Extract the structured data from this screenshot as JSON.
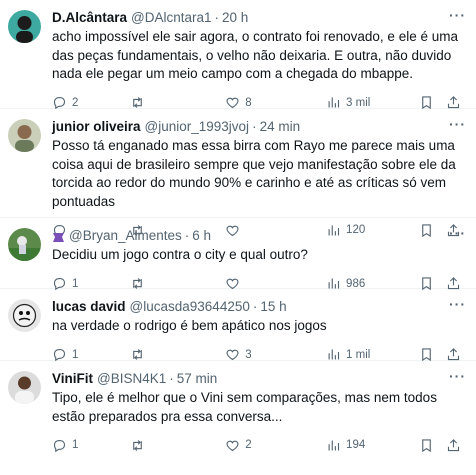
{
  "tweets": [
    {
      "name": "D.Alcântara",
      "handle": "@DAlcntara1",
      "time": "20 h",
      "text": "acho impossível ele sair agora, o contrato foi renovado, e ele é uma das peças fundamentais, o velho não deixaria. E outra, não duvido nada ele pegar um meio campo com a chegada do mbappe.",
      "replies": "2",
      "retweets": "",
      "likes": "8",
      "views": "3 mil"
    },
    {
      "name": "junior oliveira",
      "handle": "@junior_1993jvoj",
      "time": "24 min",
      "text": "Posso tá enganado mas essa birra com Rayo me parece mais uma coisa aqui de brasileiro sempre que vejo manifestação sobre ele da torcida ao redor do mundo 90% e carinho e até as críticas só vem pontuadas",
      "replies": "",
      "retweets": "",
      "likes": "",
      "views": "120"
    },
    {
      "name": "",
      "handle": "@Bryan_Almentes",
      "time": "6 h",
      "text": "Decidiu um jogo contra o city e qual outro?",
      "replies": "1",
      "retweets": "",
      "likes": "",
      "views": "986"
    },
    {
      "name": "lucas david",
      "handle": "@lucasda93644250",
      "time": "15 h",
      "text": "na verdade o rodrigo é bem apático nos jogos",
      "replies": "1",
      "retweets": "",
      "likes": "3",
      "views": "1 mil"
    },
    {
      "name": "ViniFit",
      "handle": "@BISN4K1",
      "time": "57 min",
      "text": "Tipo, ele é melhor que o Vini sem comparações, mas nem todos estão preparados pra essa conversa...",
      "replies": "1",
      "retweets": "",
      "likes": "2",
      "views": "194"
    }
  ],
  "icons": {
    "reply": "reply-icon",
    "retweet": "retweet-icon",
    "like": "like-icon",
    "views": "views-icon",
    "bookmark": "bookmark-icon",
    "share": "share-icon",
    "more": "more-icon"
  },
  "colors": {
    "text": "#0f1419",
    "secondary": "#536471",
    "divider": "#eff3f4"
  }
}
